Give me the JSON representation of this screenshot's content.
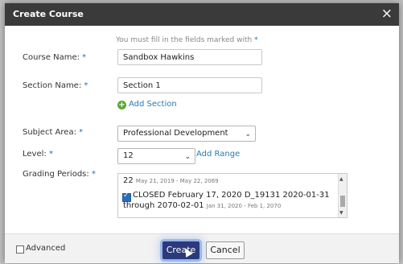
{
  "dialog": {
    "title": "Create Course",
    "close_glyph": "×",
    "required_note": "You must fill in the fields marked with",
    "required_star": "*"
  },
  "form": {
    "course_name": {
      "label": "Course Name:",
      "value": "Sandbox Hawkins"
    },
    "section_name": {
      "label": "Section Name:",
      "value": "Section 1"
    },
    "add_section": "Add Section",
    "subject_area": {
      "label": "Subject Area:",
      "value": "Professional Development"
    },
    "level": {
      "label": "Level:",
      "value": "12"
    },
    "add_range": "Add Range",
    "grading_periods": {
      "label": "Grading Periods:",
      "items": [
        {
          "text": "22",
          "dates": "May 21, 2019 - May 22, 2069",
          "checked": false
        },
        {
          "text": "CLOSED February 17, 2020 D_19131 2020-01-31",
          "continuation": "through 2070-02-01",
          "dates": "Jan 31, 2020 - Feb 1, 2070",
          "checked": true
        }
      ]
    }
  },
  "footer": {
    "advanced_label": "Advanced",
    "advanced_checked": false,
    "create_label": "Create",
    "cancel_label": "Cancel"
  },
  "icons": {
    "add_section": "plus-circle-icon",
    "close": "close-icon",
    "caret": "chevron-down-icon"
  },
  "colors": {
    "titlebar": "#3a3a3a",
    "accent": "#2a6dbf",
    "link": "#2a7ab0",
    "add_icon": "#5aa832",
    "create_button": "#2a3a7a"
  }
}
